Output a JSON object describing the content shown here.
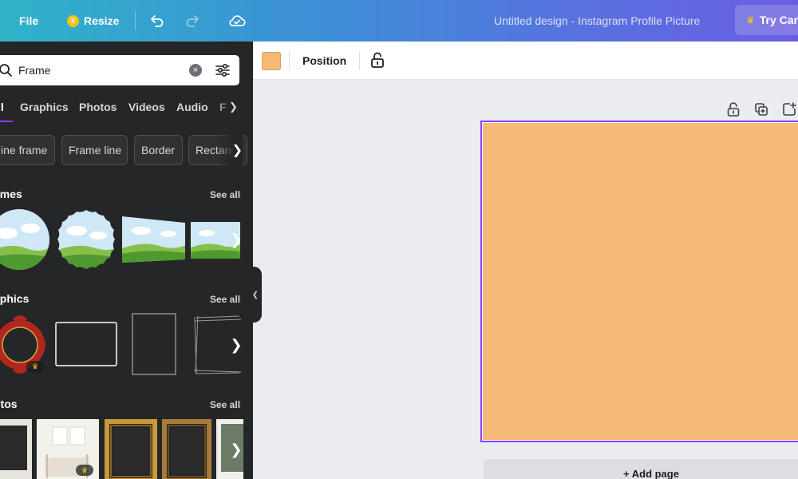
{
  "topbar": {
    "file_label": "File",
    "resize_label": "Resize",
    "design_title": "Untitled design - Instagram Profile Picture",
    "try_label": "Try Can"
  },
  "sidebar": {
    "search": {
      "value": "Frame"
    },
    "tabs": [
      {
        "label": "ll",
        "active": true
      },
      {
        "label": "Graphics"
      },
      {
        "label": "Photos"
      },
      {
        "label": "Videos"
      },
      {
        "label": "Audio"
      },
      {
        "label": "F"
      }
    ],
    "chips": [
      "ine frame",
      "Frame line",
      "Border",
      "Rectang"
    ],
    "sections": [
      {
        "title": "ames",
        "see_all": "See all"
      },
      {
        "title": "aphics",
        "see_all": "See all"
      },
      {
        "title": "otos",
        "see_all": "See all"
      }
    ]
  },
  "editor_toolbar": {
    "fill_color": "#f5b978",
    "position_label": "Position"
  },
  "canvas": {
    "page_color": "#f5b978",
    "selection_color": "#8b3dff",
    "add_page_label": "+ Add page"
  },
  "icons": [
    "search-icon",
    "clear-icon",
    "filter-icon",
    "undo-icon",
    "redo-icon",
    "cloud-sync-icon",
    "crown-icon",
    "lock-icon",
    "duplicate-icon",
    "add-icon",
    "chevron-right-icon",
    "chevron-left-icon"
  ]
}
